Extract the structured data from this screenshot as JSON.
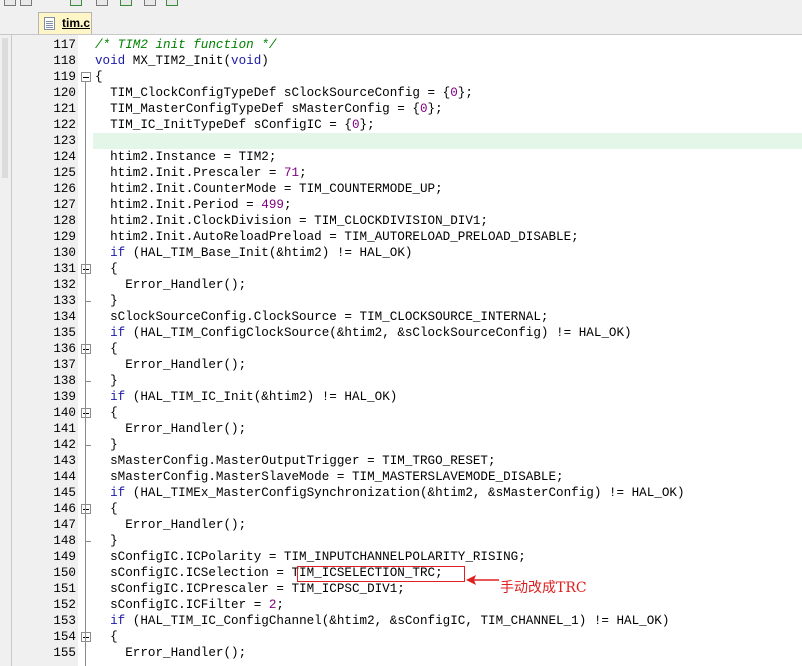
{
  "tab": {
    "filename": "tim.c"
  },
  "lines": [
    {
      "n": "117",
      "code": "/* TIM2 init function */",
      "style": "comment"
    },
    {
      "n": "118",
      "code": "void MX_TIM2_Init(void)",
      "style": "func"
    },
    {
      "n": "119",
      "code": "{",
      "fold": "open"
    },
    {
      "n": "120",
      "code": "  TIM_ClockConfigTypeDef sClockSourceConfig = {0};"
    },
    {
      "n": "121",
      "code": "  TIM_MasterConfigTypeDef sMasterConfig = {0};"
    },
    {
      "n": "122",
      "code": "  TIM_IC_InitTypeDef sConfigIC = {0};"
    },
    {
      "n": "123",
      "code": "",
      "highlight": true
    },
    {
      "n": "124",
      "code": "  htim2.Instance = TIM2;"
    },
    {
      "n": "125",
      "code": "  htim2.Init.Prescaler = 71;"
    },
    {
      "n": "126",
      "code": "  htim2.Init.CounterMode = TIM_COUNTERMODE_UP;"
    },
    {
      "n": "127",
      "code": "  htim2.Init.Period = 499;"
    },
    {
      "n": "128",
      "code": "  htim2.Init.ClockDivision = TIM_CLOCKDIVISION_DIV1;"
    },
    {
      "n": "129",
      "code": "  htim2.Init.AutoReloadPreload = TIM_AUTORELOAD_PRELOAD_DISABLE;"
    },
    {
      "n": "130",
      "code": "  if (HAL_TIM_Base_Init(&htim2) != HAL_OK)"
    },
    {
      "n": "131",
      "code": "  {",
      "fold": "open"
    },
    {
      "n": "132",
      "code": "    Error_Handler();"
    },
    {
      "n": "133",
      "code": "  }",
      "fold": "end"
    },
    {
      "n": "134",
      "code": "  sClockSourceConfig.ClockSource = TIM_CLOCKSOURCE_INTERNAL;"
    },
    {
      "n": "135",
      "code": "  if (HAL_TIM_ConfigClockSource(&htim2, &sClockSourceConfig) != HAL_OK)"
    },
    {
      "n": "136",
      "code": "  {",
      "fold": "open"
    },
    {
      "n": "137",
      "code": "    Error_Handler();"
    },
    {
      "n": "138",
      "code": "  }",
      "fold": "end"
    },
    {
      "n": "139",
      "code": "  if (HAL_TIM_IC_Init(&htim2) != HAL_OK)"
    },
    {
      "n": "140",
      "code": "  {",
      "fold": "open"
    },
    {
      "n": "141",
      "code": "    Error_Handler();"
    },
    {
      "n": "142",
      "code": "  }",
      "fold": "end"
    },
    {
      "n": "143",
      "code": "  sMasterConfig.MasterOutputTrigger = TIM_TRGO_RESET;"
    },
    {
      "n": "144",
      "code": "  sMasterConfig.MasterSlaveMode = TIM_MASTERSLAVEMODE_DISABLE;"
    },
    {
      "n": "145",
      "code": "  if (HAL_TIMEx_MasterConfigSynchronization(&htim2, &sMasterConfig) != HAL_OK)"
    },
    {
      "n": "146",
      "code": "  {",
      "fold": "open"
    },
    {
      "n": "147",
      "code": "    Error_Handler();"
    },
    {
      "n": "148",
      "code": "  }",
      "fold": "end"
    },
    {
      "n": "149",
      "code": "  sConfigIC.ICPolarity = TIM_INPUTCHANNELPOLARITY_RISING;"
    },
    {
      "n": "150",
      "code": "  sConfigIC.ICSelection = TIM_ICSELECTION_TRC;"
    },
    {
      "n": "151",
      "code": "  sConfigIC.ICPrescaler = TIM_ICPSC_DIV1;"
    },
    {
      "n": "152",
      "code": "  sConfigIC.ICFilter = 2;"
    },
    {
      "n": "153",
      "code": "  if (HAL_TIM_IC_ConfigChannel(&htim2, &sConfigIC, TIM_CHANNEL_1) != HAL_OK)"
    },
    {
      "n": "154",
      "code": "  {",
      "fold": "open"
    },
    {
      "n": "155",
      "code": "    Error_Handler();"
    }
  ],
  "annotation": {
    "text": "手动改成TRC"
  },
  "colors": {
    "annotation": "#e02020",
    "current_line": "#e4f6e8",
    "keyword": "#1a1aa6",
    "comment": "#008000",
    "number": "#800080"
  }
}
